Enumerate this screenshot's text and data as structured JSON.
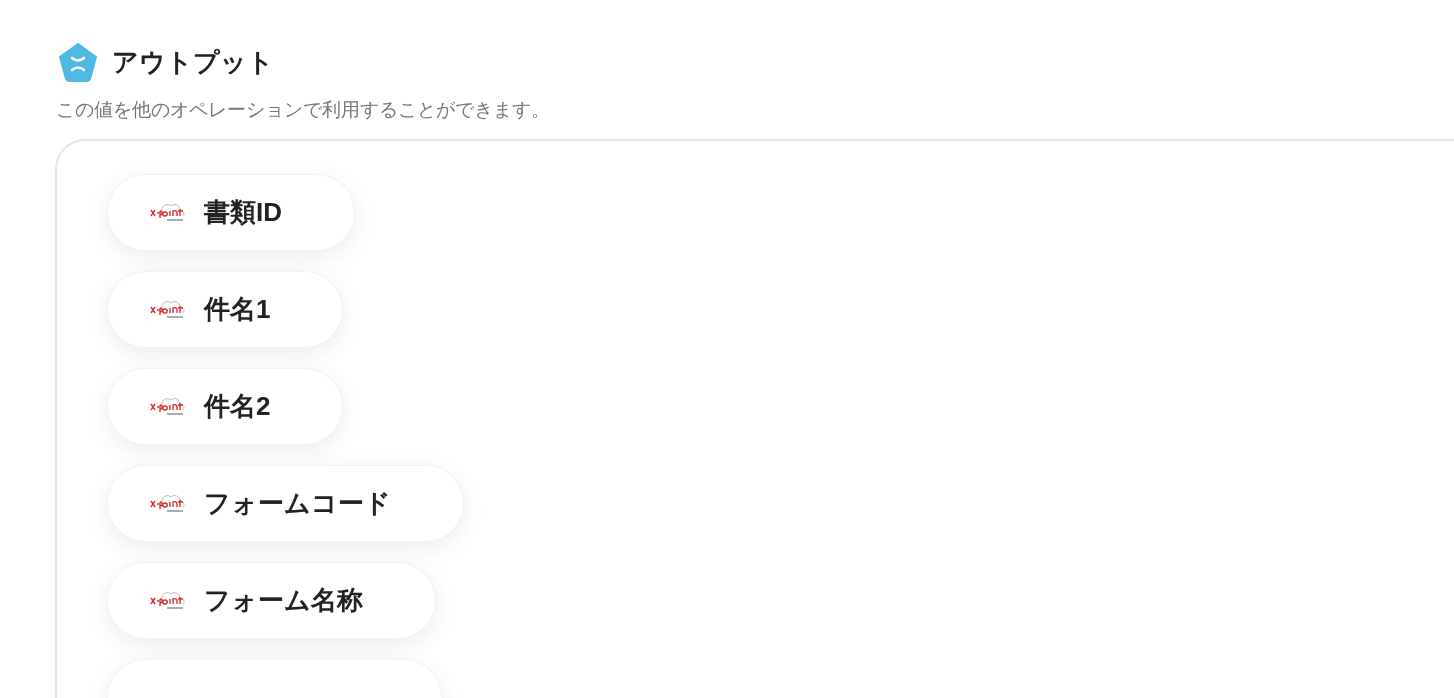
{
  "heading": "アウトプット",
  "description": "この値を他のオペレーションで利用することができます。",
  "items": [
    {
      "label": "書類ID"
    },
    {
      "label": "件名1"
    },
    {
      "label": "件名2"
    },
    {
      "label": "フォームコード"
    },
    {
      "label": "フォーム名称"
    }
  ],
  "partial_item": true
}
